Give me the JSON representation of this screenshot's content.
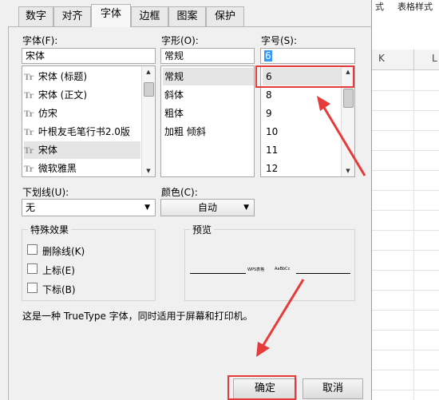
{
  "background_sheet": {
    "menu_items": [
      "式",
      "表格样式"
    ],
    "column_letters": [
      "K",
      "L"
    ]
  },
  "tabs": [
    {
      "label": "数字",
      "active": false
    },
    {
      "label": "对齐",
      "active": false
    },
    {
      "label": "字体",
      "active": true
    },
    {
      "label": "边框",
      "active": false
    },
    {
      "label": "图案",
      "active": false
    },
    {
      "label": "保护",
      "active": false
    }
  ],
  "font": {
    "label": "字体(F):",
    "value": "宋体",
    "items": [
      "宋体 (标题)",
      "宋体 (正文)",
      "仿宋",
      "叶根友毛笔行书2.0版",
      "宋体",
      "微软雅黑"
    ],
    "selected_index": 4,
    "glyph": "Tr"
  },
  "style": {
    "label": "字形(O):",
    "value": "常规",
    "items": [
      "常规",
      "斜体",
      "粗体",
      "加粗 倾斜"
    ],
    "selected_index": 0
  },
  "size": {
    "label": "字号(S):",
    "value": "6",
    "items": [
      "6",
      "8",
      "9",
      "10",
      "11",
      "12"
    ],
    "selected_index": 0
  },
  "underline": {
    "label": "下划线(U):",
    "value": "无"
  },
  "color": {
    "label": "颜色(C):",
    "value": "自动"
  },
  "effects": {
    "title": "特殊效果",
    "options": [
      {
        "label": "删除线(K)",
        "checked": false
      },
      {
        "label": "上标(E)",
        "checked": false
      },
      {
        "label": "下标(B)",
        "checked": false
      }
    ]
  },
  "preview": {
    "title": "预览",
    "sample_left": "WPS表格",
    "sample_right": "AaBbCc"
  },
  "info_text": "这是一种 TrueType 字体，同时适用于屏幕和打印机。",
  "buttons": {
    "ok": "确定",
    "cancel": "取消"
  },
  "icons": {
    "dropdown_arrow": "▼",
    "scroll_up": "▲",
    "scroll_down": "▼"
  },
  "annotation_color": "#e63b3b"
}
